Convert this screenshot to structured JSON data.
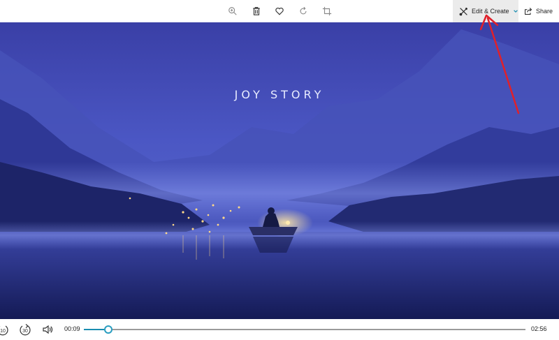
{
  "toolbar": {
    "icons": [
      "zoom-icon",
      "delete-icon",
      "favorite-icon",
      "rotate-icon",
      "crop-icon"
    ],
    "edit_create_label": "Edit & Create",
    "share_label": "Share"
  },
  "video": {
    "title": "JOY STORY"
  },
  "controls": {
    "skip_back_label": "10",
    "skip_forward_label": "30",
    "current_time": "00:09",
    "total_time": "02:56",
    "progress": 0.055
  },
  "colors": {
    "accent": "#1a8db0",
    "annotation": "#e0202a",
    "edit_button_bg": "#ebebeb"
  }
}
